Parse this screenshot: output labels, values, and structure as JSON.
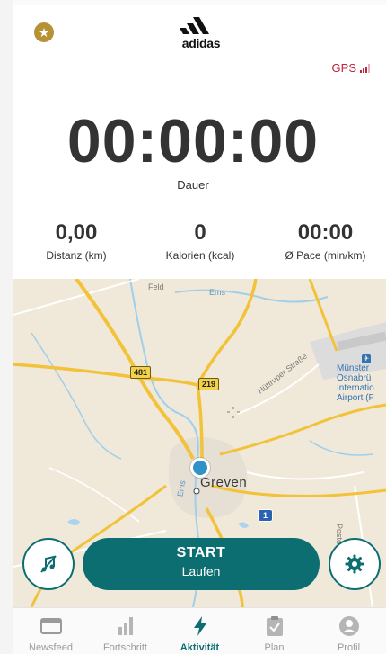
{
  "header": {
    "brand": "adidas",
    "gps_label": "GPS",
    "star_icon": "star-icon"
  },
  "timer": {
    "value": "00:00:00",
    "label": "Dauer"
  },
  "stats": [
    {
      "value": "0,00",
      "label": "Distanz (km)"
    },
    {
      "value": "0",
      "label": "Kalorien (kcal)"
    },
    {
      "value": "00:00",
      "label": "Ø Pace (min/km)"
    }
  ],
  "map": {
    "town": "Greven",
    "labels": {
      "feld": "Feld",
      "ems_top": "Ems",
      "ems_river": "Ems",
      "street": "Hüttruper Straße",
      "postdam": "Postdam"
    },
    "airport": [
      "Münster",
      "Osnabrü",
      "Internatio",
      "Airport (F"
    ],
    "shields": {
      "b481": "481",
      "b219": "219",
      "a1": "1"
    }
  },
  "controls": {
    "music_icon": "music-off-icon",
    "start_label": "START",
    "start_sub": "Laufen",
    "settings_icon": "gear-icon"
  },
  "tabs": [
    {
      "label": "Newsfeed",
      "icon": "newsfeed-icon"
    },
    {
      "label": "Fortschritt",
      "icon": "progress-chart-icon"
    },
    {
      "label": "Aktivität",
      "icon": "lightning-icon",
      "active": true
    },
    {
      "label": "Plan",
      "icon": "clipboard-icon"
    },
    {
      "label": "Profil",
      "icon": "profile-icon"
    }
  ],
  "colors": {
    "accent": "#0d6e72",
    "gps": "#c1223c",
    "badge": "#b59233"
  }
}
